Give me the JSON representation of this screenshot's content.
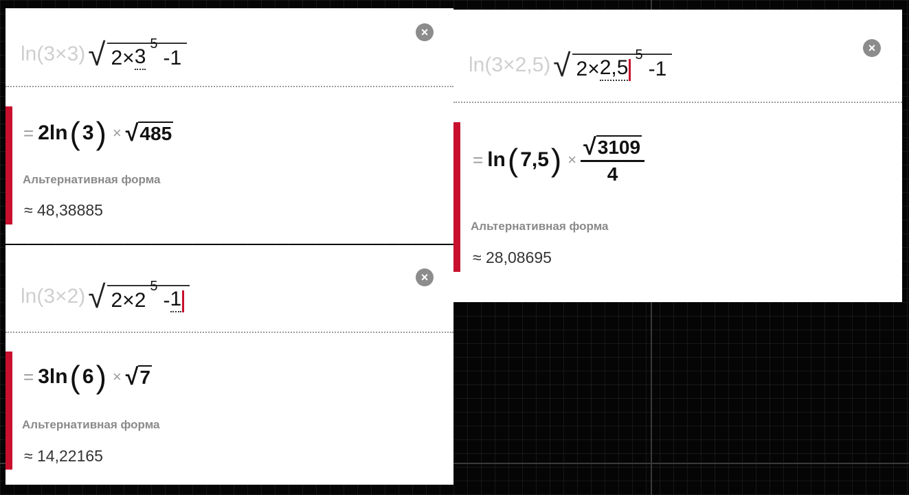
{
  "cards": [
    {
      "input": {
        "fn": "ln",
        "arg": "3×3",
        "coef": "2×",
        "base": "3",
        "exp": "5",
        "tail": "-1"
      },
      "result": {
        "eq": "=",
        "factor": "2ln",
        "arg": "3",
        "times": "×",
        "radicand": "485"
      },
      "alt_label": "Альтернативная форма",
      "approx": "≈ 48,38885"
    },
    {
      "input": {
        "fn": "ln",
        "arg": "3×2",
        "coef": "2×",
        "base": "2",
        "exp": "5",
        "minus": "-",
        "last": "1"
      },
      "result": {
        "eq": "=",
        "factor": "3ln",
        "arg": "6",
        "times": "×",
        "radicand": "7"
      },
      "alt_label": "Альтернативная форма",
      "approx": "≈ 14,22165"
    },
    {
      "input": {
        "fn": "ln",
        "arg": "3×2,5",
        "coef": "2×",
        "base": "2,5",
        "exp": "5",
        "tail": "-1"
      },
      "result": {
        "eq": "=",
        "factor": "ln",
        "arg": "7,5",
        "times": "×",
        "radicand": "3109",
        "denominator": "4"
      },
      "alt_label": "Альтернативная форма",
      "approx": "≈ 28,08695"
    }
  ],
  "icons": {
    "clear": "close-circle-icon"
  },
  "colors": {
    "accent": "#c8102e",
    "ghost_text": "#cfcfcf",
    "label_gray": "#8a8a8a",
    "background": "#050505"
  }
}
